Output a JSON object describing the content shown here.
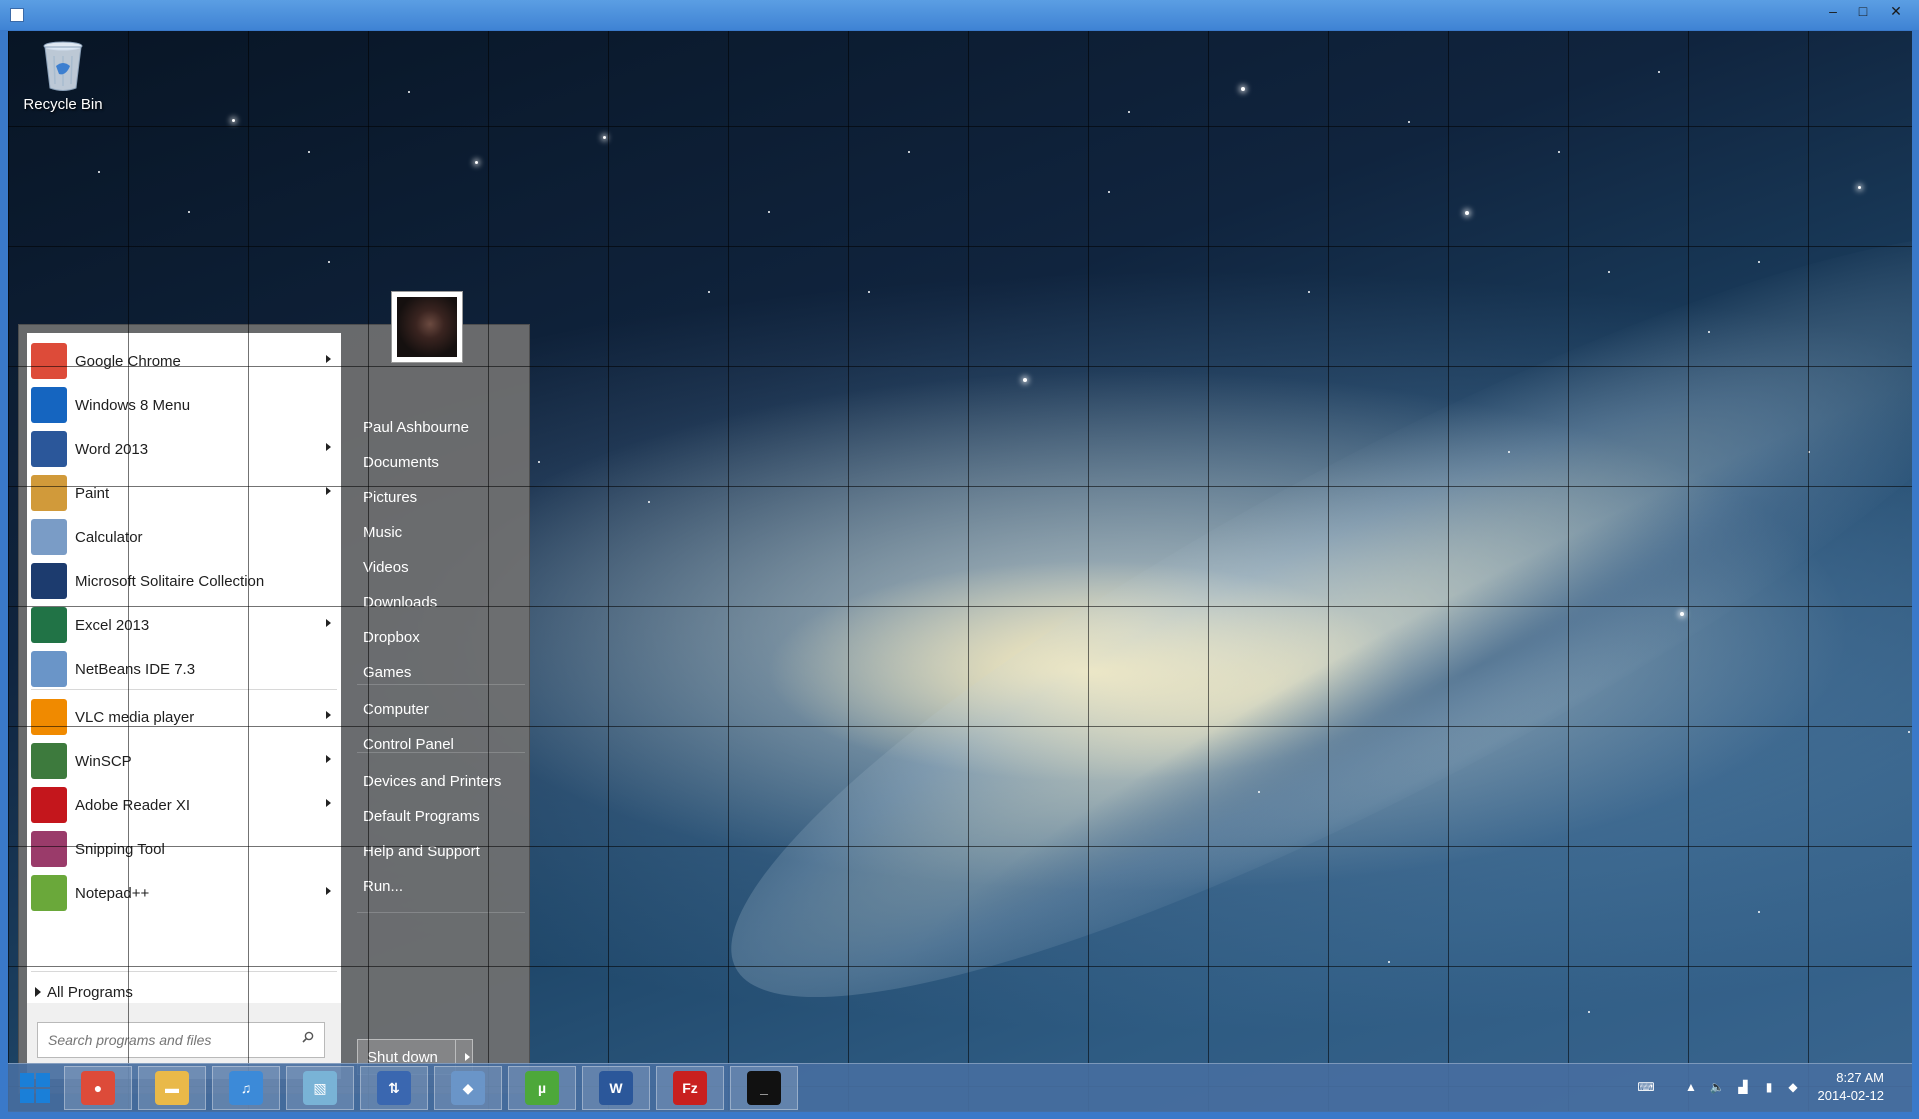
{
  "window": {
    "minimize": "–",
    "maximize": "□",
    "close": "✕"
  },
  "desktop": {
    "recycle_bin_label": "Recycle Bin"
  },
  "start_menu": {
    "user_name": "Paul Ashbourne",
    "programs": [
      {
        "label": "Google Chrome",
        "icon": "chrome-icon",
        "has_arrow": true,
        "color": "#dd4b39"
      },
      {
        "label": "Windows 8 Menu",
        "icon": "windows-8-menu-icon",
        "has_arrow": false,
        "color": "#1565c0"
      },
      {
        "label": "Word 2013",
        "icon": "word-icon",
        "has_arrow": true,
        "color": "#2b579a"
      },
      {
        "label": "Paint",
        "icon": "paint-icon",
        "has_arrow": true,
        "color": "#d19a3a"
      },
      {
        "label": "Calculator",
        "icon": "calculator-icon",
        "has_arrow": false,
        "color": "#7a9cc6"
      },
      {
        "label": "Microsoft Solitaire Collection",
        "icon": "solitaire-icon",
        "has_arrow": false,
        "color": "#1c3b6e"
      },
      {
        "label": "Excel 2013",
        "icon": "excel-icon",
        "has_arrow": true,
        "color": "#217346"
      },
      {
        "label": "NetBeans IDE 7.3",
        "icon": "netbeans-icon",
        "has_arrow": false,
        "color": "#6a95c8"
      },
      {
        "label": "VLC media player",
        "icon": "vlc-icon",
        "has_arrow": true,
        "color": "#f08a00"
      },
      {
        "label": "WinSCP",
        "icon": "winscp-icon",
        "has_arrow": true,
        "color": "#3d7a3d"
      },
      {
        "label": "Adobe Reader XI",
        "icon": "adobe-reader-icon",
        "has_arrow": true,
        "color": "#c4161c"
      },
      {
        "label": "Snipping Tool",
        "icon": "snipping-tool-icon",
        "has_arrow": false,
        "color": "#9a3b6a"
      },
      {
        "label": "Notepad++",
        "icon": "notepadpp-icon",
        "has_arrow": true,
        "color": "#6aa83a"
      }
    ],
    "all_programs": "All Programs",
    "search_placeholder": "Search programs and files",
    "places": [
      {
        "label": "Documents"
      },
      {
        "label": "Pictures"
      },
      {
        "label": "Music"
      },
      {
        "label": "Videos"
      },
      {
        "label": "Downloads"
      },
      {
        "label": "Dropbox"
      },
      {
        "label": "Games"
      },
      {
        "label": "Computer"
      },
      {
        "label": "Control Panel"
      },
      {
        "label": "Devices and Printers"
      },
      {
        "label": "Default Programs"
      },
      {
        "label": "Help and Support"
      },
      {
        "label": "Run..."
      }
    ],
    "shutdown_label": "Shut down"
  },
  "taskbar": {
    "apps": [
      {
        "name": "chrome",
        "icon": "chrome-icon",
        "color": "#dd4b39",
        "glyph": "●"
      },
      {
        "name": "file-explorer",
        "icon": "folder-icon",
        "color": "#e9b949",
        "glyph": "▬"
      },
      {
        "name": "itunes",
        "icon": "itunes-icon",
        "color": "#3c8ad8",
        "glyph": "♫"
      },
      {
        "name": "notepad",
        "icon": "notepad-icon",
        "color": "#79b3d6",
        "glyph": "▧"
      },
      {
        "name": "network",
        "icon": "network-icon",
        "color": "#3a67b0",
        "glyph": "⇅"
      },
      {
        "name": "netbeans",
        "icon": "netbeans-icon",
        "color": "#6a95c8",
        "glyph": "◆"
      },
      {
        "name": "utorrent",
        "icon": "utorrent-icon",
        "color": "#4da83a",
        "glyph": "µ"
      },
      {
        "name": "word",
        "icon": "word-icon",
        "color": "#2b579a",
        "glyph": "W"
      },
      {
        "name": "filezilla",
        "icon": "filezilla-icon",
        "color": "#c9201f",
        "glyph": "Fz"
      },
      {
        "name": "command-prompt",
        "icon": "command-prompt-icon",
        "color": "#111111",
        "glyph": "_"
      }
    ],
    "clock_time": "8:27 AM",
    "clock_date": "2014-02-12"
  }
}
